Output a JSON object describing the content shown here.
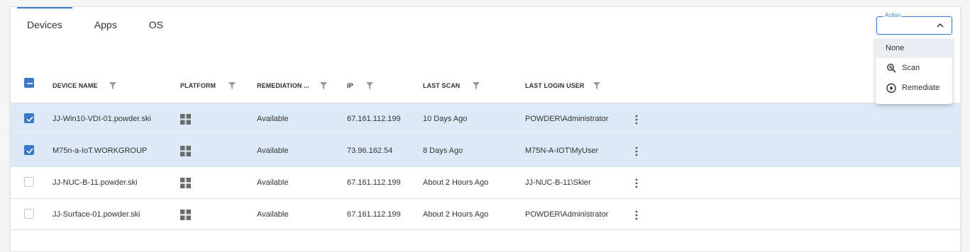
{
  "tabs": [
    {
      "label": "Devices",
      "active": true
    },
    {
      "label": "Apps",
      "active": false
    },
    {
      "label": "OS",
      "active": false
    }
  ],
  "action": {
    "legend": "Action",
    "menu": [
      {
        "label": "None",
        "icon": "",
        "highlighted": true
      },
      {
        "label": "Scan",
        "icon": "scan-icon",
        "highlighted": false
      },
      {
        "label": "Remediate",
        "icon": "remediate-icon",
        "highlighted": false
      }
    ]
  },
  "columns": {
    "device_name": "DEVICE NAME",
    "platform": "PLATFORM",
    "remediation": "REMEDIATION ...",
    "ip": "IP",
    "last_scan": "LAST SCAN",
    "last_login_user": "LAST LOGIN USER"
  },
  "rows": [
    {
      "device_name": "JJ-Win10-VDI-01.powder.ski",
      "platform_icon": "windows-icon",
      "remediation": "Available",
      "ip": "67.161.112.199",
      "last_scan": "10 Days Ago",
      "last_login_user": "POWDER\\Administrator",
      "selected": true
    },
    {
      "device_name": "M75n-a-IoT.WORKGROUP",
      "platform_icon": "windows-icon",
      "remediation": "Available",
      "ip": "73.96.162.54",
      "last_scan": "8 Days Ago",
      "last_login_user": "M75N-A-IOT\\MyUser",
      "selected": true
    },
    {
      "device_name": "JJ-NUC-B-11.powder.ski",
      "platform_icon": "windows-icon",
      "remediation": "Available",
      "ip": "67.161.112.199",
      "last_scan": "About 2 Hours Ago",
      "last_login_user": "JJ-NUC-B-11\\Skier",
      "selected": false
    },
    {
      "device_name": "JJ-Surface-01.powder.ski",
      "platform_icon": "windows-icon",
      "remediation": "Available",
      "ip": "67.161.112.199",
      "last_scan": "About 2 Hours Ago",
      "last_login_user": "POWDER\\Administrator",
      "selected": false
    }
  ],
  "colors": {
    "accent": "#3a78c9",
    "selected_row": "#dbeaf6"
  }
}
